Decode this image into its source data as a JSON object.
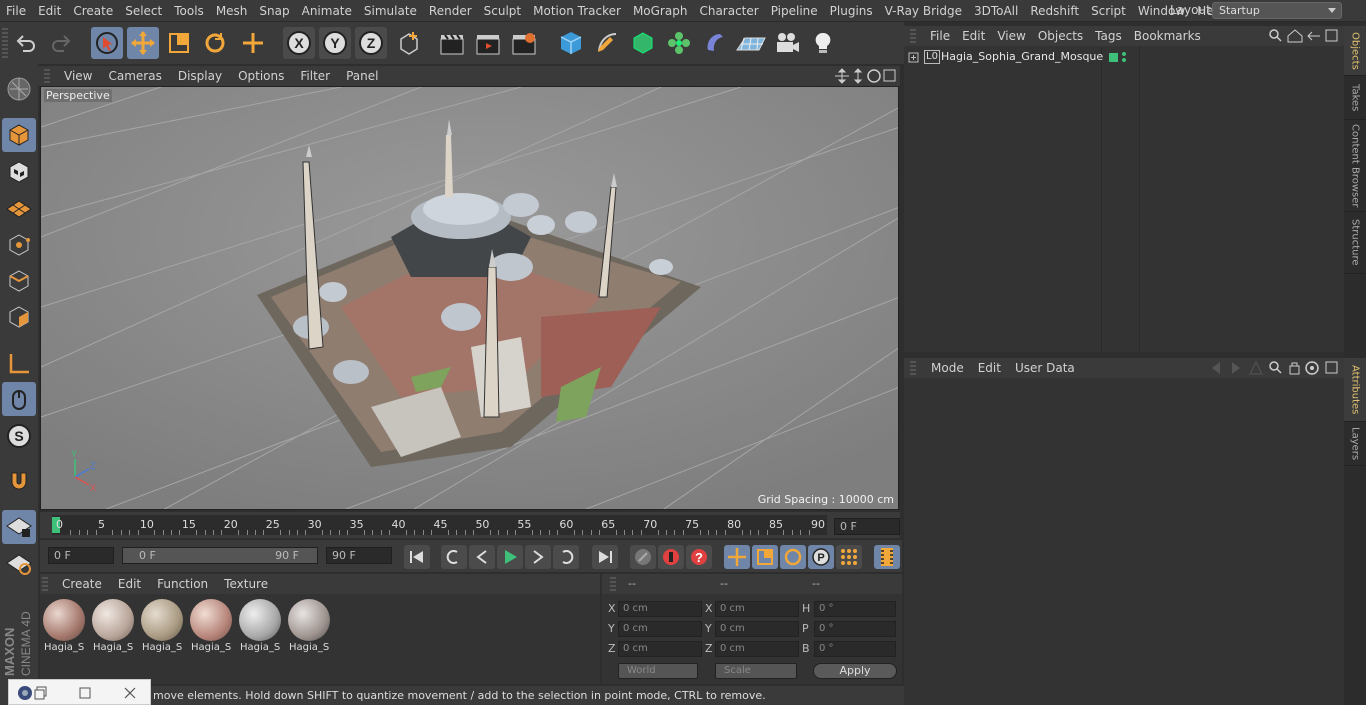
{
  "menu": [
    "File",
    "Edit",
    "Create",
    "Select",
    "Tools",
    "Mesh",
    "Snap",
    "Animate",
    "Simulate",
    "Render",
    "Sculpt",
    "Motion Tracker",
    "MoGraph",
    "Character",
    "Pipeline",
    "Plugins",
    "V-Ray Bridge",
    "3DToAll",
    "Redshift",
    "Script",
    "Window",
    "Help"
  ],
  "layout": {
    "label": "Layout:",
    "value": "Startup"
  },
  "viewport": {
    "menu": [
      "View",
      "Cameras",
      "Display",
      "Options",
      "Filter",
      "Panel"
    ],
    "label": "Perspective",
    "grid_spacing": "Grid Spacing : 10000 cm"
  },
  "timeline": {
    "ticks": [
      "0",
      "5",
      "10",
      "15",
      "20",
      "25",
      "30",
      "35",
      "40",
      "45",
      "50",
      "55",
      "60",
      "65",
      "70",
      "75",
      "80",
      "85",
      "90"
    ],
    "current_frame": "0 F"
  },
  "playback": {
    "start": "0 F",
    "range_start": "0 F",
    "range_end": "90 F",
    "end": "90 F"
  },
  "materials": {
    "menu": [
      "Create",
      "Edit",
      "Function",
      "Texture"
    ],
    "items": [
      "Hagia_S",
      "Hagia_S",
      "Hagia_S",
      "Hagia_S",
      "Hagia_S",
      "Hagia_S"
    ]
  },
  "coords": {
    "headers": [
      "--",
      "--",
      "--"
    ],
    "rows": [
      {
        "a": "X",
        "av": "0 cm",
        "b": "X",
        "bv": "0 cm",
        "c": "H",
        "cv": "0 °"
      },
      {
        "a": "Y",
        "av": "0 cm",
        "b": "Y",
        "bv": "0 cm",
        "c": "P",
        "cv": "0 °"
      },
      {
        "a": "Z",
        "av": "0 cm",
        "b": "Z",
        "bv": "0 cm",
        "c": "B",
        "cv": "0 °"
      }
    ],
    "world": "World",
    "scale": "Scale",
    "apply": "Apply"
  },
  "status": "move elements. Hold down SHIFT to quantize movement / add to the selection in point mode, CTRL to remove.",
  "objects": {
    "menu": [
      "File",
      "Edit",
      "View",
      "Objects",
      "Tags",
      "Bookmarks"
    ],
    "item": "Hagia_Sophia_Grand_Mosque",
    "layer": "L0"
  },
  "attributes": {
    "menu": [
      "Mode",
      "Edit",
      "User Data"
    ]
  },
  "side_tabs": [
    "Objects",
    "Takes",
    "Content Browser",
    "Structure",
    "Attributes",
    "Layers"
  ],
  "brand": {
    "maxon": "MAXON",
    "cinema": "CINEMA 4D"
  },
  "colors": {
    "accent": "#6f86a8",
    "viewport": "#8a8a8a",
    "panel": "#333333",
    "green": "#3ec07a"
  }
}
